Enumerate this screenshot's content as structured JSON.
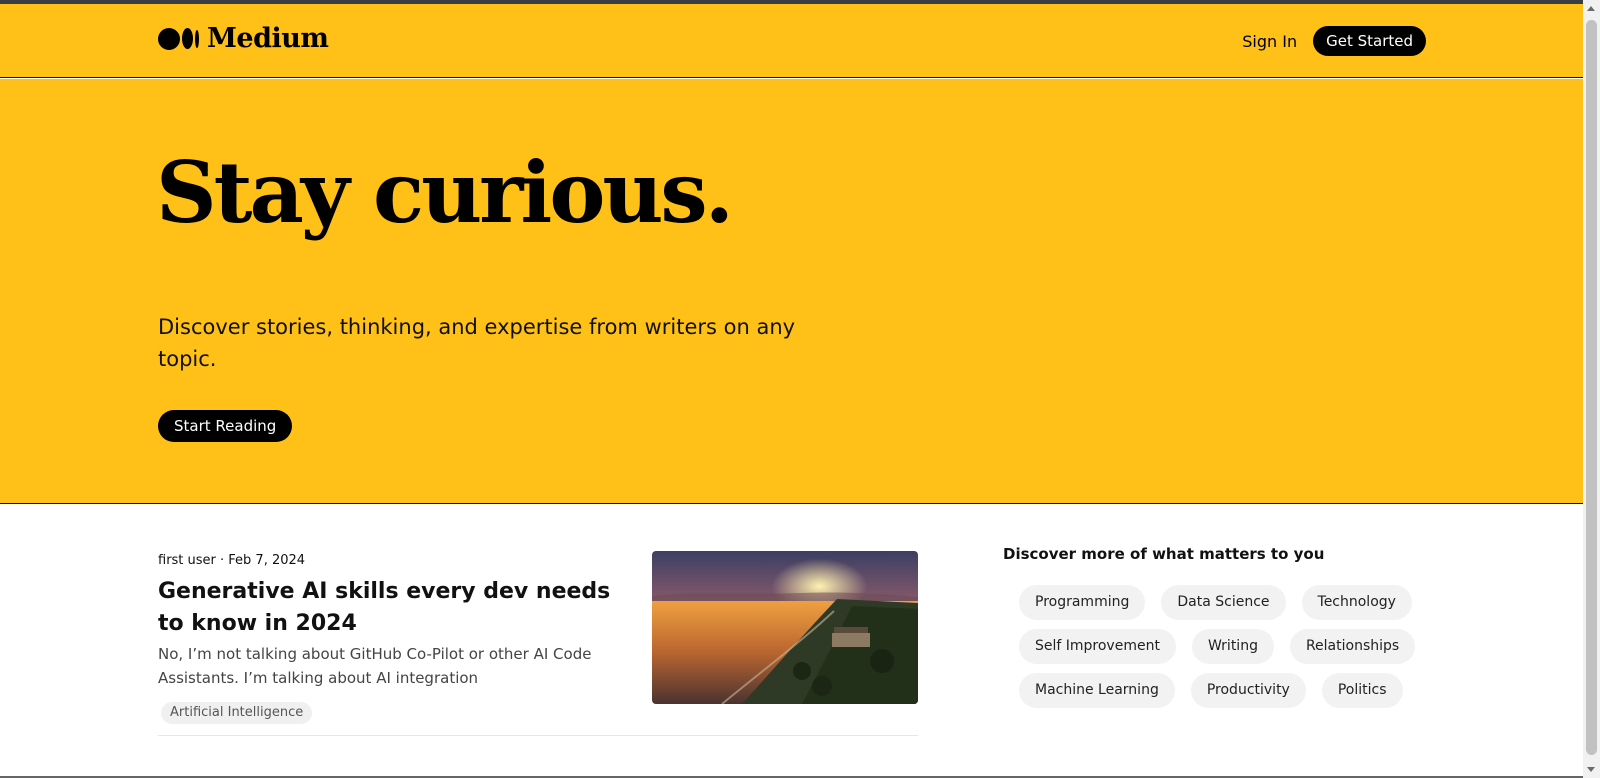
{
  "header": {
    "logo_text": "Medium",
    "sign_in_label": "Sign In",
    "get_started_label": "Get Started"
  },
  "hero": {
    "title": "Stay curious.",
    "subtitle": "Discover stories, thinking, and expertise from writers on any topic.",
    "cta_label": "Start Reading"
  },
  "article": {
    "meta": "first user · Feb 7, 2024",
    "title": "Generative AI skills every dev needs to know in 2024",
    "excerpt": "No, I’m not talking about GitHub Co-Pilot or other AI Code Assistants. I’m talking about AI integration",
    "tag": "Artificial Intelligence"
  },
  "discover": {
    "title": "Discover more of what matters to you",
    "topics": [
      "Programming",
      "Data Science",
      "Technology",
      "Self Improvement",
      "Writing",
      "Relationships",
      "Machine Learning",
      "Productivity",
      "Politics"
    ]
  },
  "colors": {
    "brand_yellow": "#ffc017",
    "button_black": "#000000",
    "chip_gray": "#f2f2f2"
  }
}
